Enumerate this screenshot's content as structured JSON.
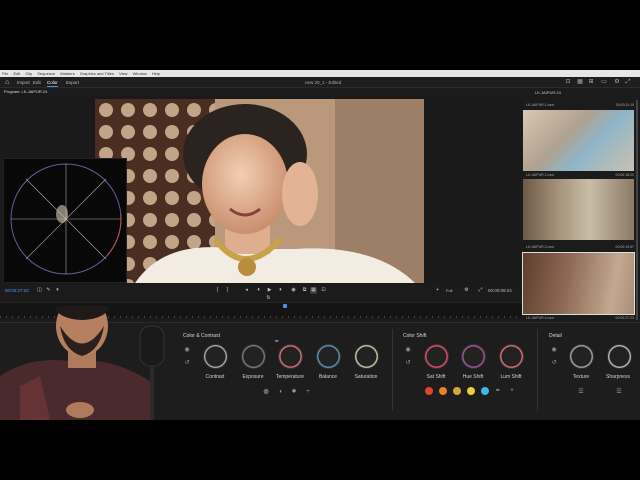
{
  "menubar": [
    "File",
    "Edit",
    "Clip",
    "Sequence",
    "Markers",
    "Graphics and Titles",
    "View",
    "Window",
    "Help"
  ],
  "workspace": {
    "tabs": [
      "Import",
      "Edit",
      "Color",
      "Export"
    ],
    "active_tab": "Color",
    "project_title": "new 20_1  -  Edited"
  },
  "program": {
    "label": "Program: LK.JAIPUR.24"
  },
  "transport": {
    "timecode_left": "00:00:27:20",
    "fit": "Full",
    "timecode_right": "00:00:09:24"
  },
  "right_panel": {
    "title": "LK.JAIPUR.24",
    "thumbnails": [
      {
        "name": "LK.JAIPUR.1.mov",
        "duration": "00:00:11:19"
      },
      {
        "name": "LK.JAIPUR.2.mov",
        "duration": "00:00:18:20"
      },
      {
        "name": "LK.JAIPUR.3.mov",
        "duration": "00:00:19:57"
      },
      {
        "name": "LK.JAIPUR.4.mov",
        "duration": "00:00:27:23"
      }
    ]
  },
  "color_contrast": {
    "title": "Color & Contrast",
    "dials": [
      "Contrast",
      "Exposure",
      "Temperature",
      "Balance",
      "Saturation"
    ]
  },
  "color_shift": {
    "title": "Color Shift",
    "dials": [
      "Sat Shift",
      "Hue Shift",
      "Lum Shift"
    ],
    "swatches": [
      "#e0452a",
      "#f07f2a",
      "#d6a63a",
      "#e8d23a",
      "#3fb8e8"
    ]
  },
  "detail": {
    "title": "Detail",
    "dials": [
      "Texture",
      "Sharpness"
    ]
  },
  "colors": {
    "accent": "#4d8cf5",
    "timecode": "#4d9bf5"
  }
}
